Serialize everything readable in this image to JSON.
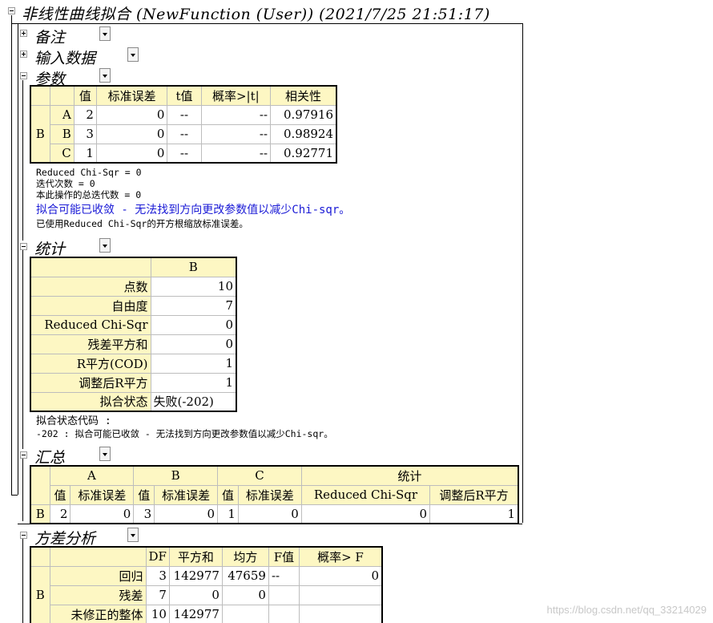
{
  "title": "非线性曲线拟合 (NewFunction (User)) (2021/7/25 21:51:17)",
  "sections": {
    "notes": "备注",
    "input": "输入数据",
    "params": "参数",
    "stats": "统计",
    "summary": "汇总",
    "anova": "方差分析"
  },
  "params": {
    "headers": [
      "值",
      "标准误差",
      "t值",
      "概率>|t|",
      "相关性"
    ],
    "group": "B",
    "rows": [
      {
        "name": "A",
        "val": "2",
        "se": "0",
        "t": "--",
        "p": "--",
        "corr": "0.97916"
      },
      {
        "name": "B",
        "val": "3",
        "se": "0",
        "t": "--",
        "p": "--",
        "corr": "0.98924"
      },
      {
        "name": "C",
        "val": "1",
        "se": "0",
        "t": "--",
        "p": "--",
        "corr": "0.92771"
      }
    ],
    "notes": [
      "Reduced Chi-Sqr = 0",
      "迭代次数 = 0",
      "本此操作的总迭代数 = 0",
      "拟合可能已收敛 - 无法找到方向更改参数值以减少Chi-sqr。",
      "已使用Reduced Chi-Sqr的开方根缩放标准误差。"
    ]
  },
  "stats": {
    "col": "B",
    "rows": [
      {
        "label": "点数",
        "value": "10"
      },
      {
        "label": "自由度",
        "value": "7"
      },
      {
        "label": "Reduced Chi-Sqr",
        "value": "0"
      },
      {
        "label": "残差平方和",
        "value": "0"
      },
      {
        "label": "R平方(COD)",
        "value": "1"
      },
      {
        "label": "调整后R平方",
        "value": "1"
      },
      {
        "label": "拟合状态",
        "value": "失败(-202)"
      }
    ],
    "notes": [
      "拟合状态代码 :",
      "-202 : 拟合可能已收敛 - 无法找到方向更改参数值以减少Chi-sqr。"
    ]
  },
  "summary": {
    "groups": [
      "A",
      "B",
      "C",
      "统计"
    ],
    "sub": [
      "值",
      "标准误差",
      "值",
      "标准误差",
      "值",
      "标准误差",
      "Reduced Chi-Sqr",
      "调整后R平方"
    ],
    "row_label": "B",
    "row": [
      "2",
      "0",
      "3",
      "0",
      "1",
      "0",
      "0",
      "1"
    ]
  },
  "anova": {
    "headers": [
      "DF",
      "平方和",
      "均方",
      "F值",
      "概率> F"
    ],
    "group": "B",
    "rows": [
      {
        "name": "回归",
        "df": "3",
        "ss": "142977",
        "ms": "47659",
        "f": "--",
        "p": "0"
      },
      {
        "name": "残差",
        "df": "7",
        "ss": "0",
        "ms": "0",
        "f": "",
        "p": ""
      },
      {
        "name": "未修正的整体",
        "df": "10",
        "ss": "142977",
        "ms": "",
        "f": "",
        "p": ""
      }
    ]
  },
  "watermark": "https://blog.csdn.net/qq_33214029"
}
